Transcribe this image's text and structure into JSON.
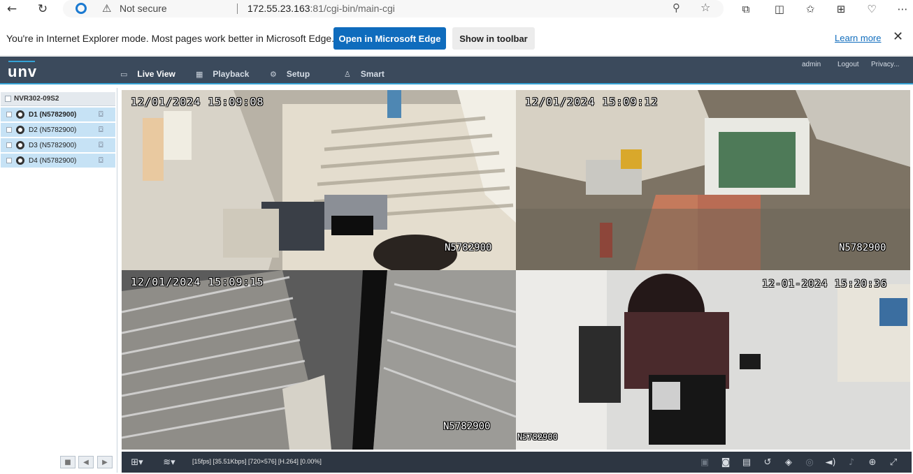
{
  "browser": {
    "not_secure": "Not secure",
    "url_host": "172.55.23.163",
    "url_rest": ":81/cgi-bin/main-cgi",
    "ie_message": "You're in Internet Explorer mode. Most pages work better in Microsoft Edge.",
    "open_edge": "Open in Microsoft Edge",
    "show_toolbar": "Show in toolbar",
    "learn_more": "Learn more"
  },
  "header": {
    "logo": "unv",
    "tabs": [
      {
        "label": "Live View",
        "icon": "monitor-icon"
      },
      {
        "label": "Playback",
        "icon": "film-icon"
      },
      {
        "label": "Setup",
        "icon": "gear-icon"
      },
      {
        "label": "Smart",
        "icon": "person-icon"
      }
    ],
    "user": "admin",
    "logout": "Logout",
    "privacy": "Privacy..."
  },
  "device": {
    "name": "NVR302-09S2",
    "channels": [
      {
        "label": "D1 (N5782900)",
        "bold": true
      },
      {
        "label": "D2 (N5782900)",
        "bold": false
      },
      {
        "label": "D3 (N5782900)",
        "bold": false
      },
      {
        "label": "D4 (N5782900)",
        "bold": false
      }
    ]
  },
  "tiles": [
    {
      "timestamp": "12/01/2024 15:09:08",
      "cam": "N5782900"
    },
    {
      "timestamp": "12/01/2024 15:09:12",
      "cam": "N5782900"
    },
    {
      "timestamp": "12/01/2024 15:09:15",
      "cam": "N5782900"
    },
    {
      "timestamp": "12-01-2024 15:20:36",
      "cam": "N5782900"
    }
  ],
  "status": {
    "stats": "[15fps] [35.51Kbps] [720×576] [H.264] [0.00%]"
  },
  "colors": {
    "header_bg": "#3b4a5c",
    "accent": "#35a3d5",
    "selected_row": "#c6e2f5",
    "edge_button": "#0f6cbd"
  }
}
